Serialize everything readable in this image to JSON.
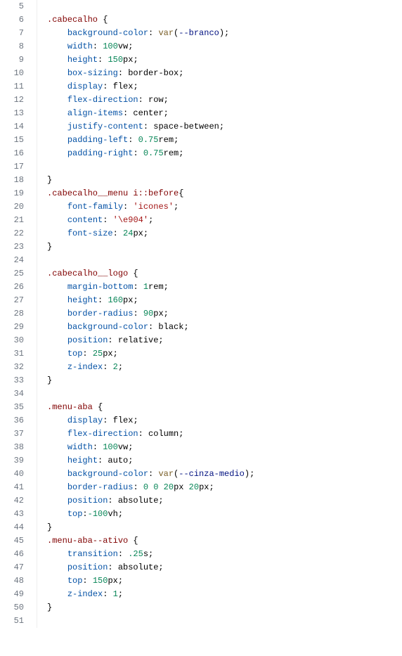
{
  "lines": [
    {
      "n": 5,
      "tokens": []
    },
    {
      "n": 6,
      "tokens": [
        [
          "sel",
          ".cabecalho"
        ],
        [
          "pun",
          " {"
        ]
      ]
    },
    {
      "n": 7,
      "tokens": [
        [
          "pun",
          "    "
        ],
        [
          "prop",
          "background-color"
        ],
        [
          "pun",
          ": "
        ],
        [
          "func",
          "var"
        ],
        [
          "pun",
          "("
        ],
        [
          "var",
          "--branco"
        ],
        [
          "pun",
          ");"
        ]
      ]
    },
    {
      "n": 8,
      "tokens": [
        [
          "pun",
          "    "
        ],
        [
          "prop",
          "width"
        ],
        [
          "pun",
          ": "
        ],
        [
          "num",
          "100"
        ],
        [
          "kw",
          "vw"
        ],
        [
          "pun",
          ";"
        ]
      ]
    },
    {
      "n": 9,
      "tokens": [
        [
          "pun",
          "    "
        ],
        [
          "prop",
          "height"
        ],
        [
          "pun",
          ": "
        ],
        [
          "num",
          "150"
        ],
        [
          "kw",
          "px"
        ],
        [
          "pun",
          ";"
        ]
      ]
    },
    {
      "n": 10,
      "tokens": [
        [
          "pun",
          "    "
        ],
        [
          "prop",
          "box-sizing"
        ],
        [
          "pun",
          ": border-box;"
        ]
      ]
    },
    {
      "n": 11,
      "tokens": [
        [
          "pun",
          "    "
        ],
        [
          "prop",
          "display"
        ],
        [
          "pun",
          ": flex;"
        ]
      ]
    },
    {
      "n": 12,
      "tokens": [
        [
          "pun",
          "    "
        ],
        [
          "prop",
          "flex-direction"
        ],
        [
          "pun",
          ": row;"
        ]
      ]
    },
    {
      "n": 13,
      "tokens": [
        [
          "pun",
          "    "
        ],
        [
          "prop",
          "align-items"
        ],
        [
          "pun",
          ": center;"
        ]
      ]
    },
    {
      "n": 14,
      "tokens": [
        [
          "pun",
          "    "
        ],
        [
          "prop",
          "justify-content"
        ],
        [
          "pun",
          ": space-between;"
        ]
      ]
    },
    {
      "n": 15,
      "tokens": [
        [
          "pun",
          "    "
        ],
        [
          "prop",
          "padding-left"
        ],
        [
          "pun",
          ": "
        ],
        [
          "num",
          "0.75"
        ],
        [
          "kw",
          "rem"
        ],
        [
          "pun",
          ";"
        ]
      ]
    },
    {
      "n": 16,
      "tokens": [
        [
          "pun",
          "    "
        ],
        [
          "prop",
          "padding-right"
        ],
        [
          "pun",
          ": "
        ],
        [
          "num",
          "0.75"
        ],
        [
          "kw",
          "rem"
        ],
        [
          "pun",
          ";"
        ]
      ]
    },
    {
      "n": 17,
      "tokens": []
    },
    {
      "n": 18,
      "tokens": [
        [
          "pun",
          "}"
        ]
      ]
    },
    {
      "n": 19,
      "tokens": [
        [
          "sel",
          ".cabecalho__menu"
        ],
        [
          "pun",
          " "
        ],
        [
          "sel",
          "i::before"
        ],
        [
          "pun",
          "{"
        ]
      ]
    },
    {
      "n": 20,
      "tokens": [
        [
          "pun",
          "    "
        ],
        [
          "prop",
          "font-family"
        ],
        [
          "pun",
          ": "
        ],
        [
          "str",
          "'icones'"
        ],
        [
          "pun",
          ";"
        ]
      ]
    },
    {
      "n": 21,
      "tokens": [
        [
          "pun",
          "    "
        ],
        [
          "prop",
          "content"
        ],
        [
          "pun",
          ": "
        ],
        [
          "str",
          "'\\e904'"
        ],
        [
          "pun",
          ";"
        ]
      ]
    },
    {
      "n": 22,
      "tokens": [
        [
          "pun",
          "    "
        ],
        [
          "prop",
          "font-size"
        ],
        [
          "pun",
          ": "
        ],
        [
          "num",
          "24"
        ],
        [
          "kw",
          "px"
        ],
        [
          "pun",
          ";"
        ]
      ]
    },
    {
      "n": 23,
      "tokens": [
        [
          "pun",
          "}"
        ]
      ]
    },
    {
      "n": 24,
      "tokens": []
    },
    {
      "n": 25,
      "tokens": [
        [
          "sel",
          ".cabecalho__logo"
        ],
        [
          "pun",
          " {"
        ]
      ]
    },
    {
      "n": 26,
      "tokens": [
        [
          "pun",
          "    "
        ],
        [
          "prop",
          "margin-bottom"
        ],
        [
          "pun",
          ": "
        ],
        [
          "num",
          "1"
        ],
        [
          "kw",
          "rem"
        ],
        [
          "pun",
          ";"
        ]
      ]
    },
    {
      "n": 27,
      "tokens": [
        [
          "pun",
          "    "
        ],
        [
          "prop",
          "height"
        ],
        [
          "pun",
          ": "
        ],
        [
          "num",
          "160"
        ],
        [
          "kw",
          "px"
        ],
        [
          "pun",
          ";"
        ]
      ]
    },
    {
      "n": 28,
      "tokens": [
        [
          "pun",
          "    "
        ],
        [
          "prop",
          "border-radius"
        ],
        [
          "pun",
          ": "
        ],
        [
          "num",
          "90"
        ],
        [
          "kw",
          "px"
        ],
        [
          "pun",
          ";"
        ]
      ]
    },
    {
      "n": 29,
      "tokens": [
        [
          "pun",
          "    "
        ],
        [
          "prop",
          "background-color"
        ],
        [
          "pun",
          ": black;"
        ]
      ]
    },
    {
      "n": 30,
      "tokens": [
        [
          "pun",
          "    "
        ],
        [
          "prop",
          "position"
        ],
        [
          "pun",
          ": relative;"
        ]
      ]
    },
    {
      "n": 31,
      "tokens": [
        [
          "pun",
          "    "
        ],
        [
          "prop",
          "top"
        ],
        [
          "pun",
          ": "
        ],
        [
          "num",
          "25"
        ],
        [
          "kw",
          "px"
        ],
        [
          "pun",
          ";"
        ]
      ]
    },
    {
      "n": 32,
      "tokens": [
        [
          "pun",
          "    "
        ],
        [
          "prop",
          "z-index"
        ],
        [
          "pun",
          ": "
        ],
        [
          "num",
          "2"
        ],
        [
          "pun",
          ";"
        ]
      ]
    },
    {
      "n": 33,
      "tokens": [
        [
          "pun",
          "}"
        ]
      ]
    },
    {
      "n": 34,
      "tokens": []
    },
    {
      "n": 35,
      "tokens": [
        [
          "sel",
          ".menu-aba"
        ],
        [
          "pun",
          " {"
        ]
      ]
    },
    {
      "n": 36,
      "tokens": [
        [
          "pun",
          "    "
        ],
        [
          "prop",
          "display"
        ],
        [
          "pun",
          ": flex;"
        ]
      ]
    },
    {
      "n": 37,
      "tokens": [
        [
          "pun",
          "    "
        ],
        [
          "prop",
          "flex-direction"
        ],
        [
          "pun",
          ": column;"
        ]
      ]
    },
    {
      "n": 38,
      "tokens": [
        [
          "pun",
          "    "
        ],
        [
          "prop",
          "width"
        ],
        [
          "pun",
          ": "
        ],
        [
          "num",
          "100"
        ],
        [
          "kw",
          "vw"
        ],
        [
          "pun",
          ";"
        ]
      ]
    },
    {
      "n": 39,
      "tokens": [
        [
          "pun",
          "    "
        ],
        [
          "prop",
          "height"
        ],
        [
          "pun",
          ": auto;"
        ]
      ]
    },
    {
      "n": 40,
      "tokens": [
        [
          "pun",
          "    "
        ],
        [
          "prop",
          "background-color"
        ],
        [
          "pun",
          ": "
        ],
        [
          "func",
          "var"
        ],
        [
          "pun",
          "("
        ],
        [
          "var",
          "--cinza-medio"
        ],
        [
          "pun",
          ");"
        ]
      ]
    },
    {
      "n": 41,
      "tokens": [
        [
          "pun",
          "    "
        ],
        [
          "prop",
          "border-radius"
        ],
        [
          "pun",
          ": "
        ],
        [
          "num",
          "0"
        ],
        [
          "pun",
          " "
        ],
        [
          "num",
          "0"
        ],
        [
          "pun",
          " "
        ],
        [
          "num",
          "20"
        ],
        [
          "kw",
          "px"
        ],
        [
          "pun",
          " "
        ],
        [
          "num",
          "20"
        ],
        [
          "kw",
          "px"
        ],
        [
          "pun",
          ";"
        ]
      ]
    },
    {
      "n": 42,
      "tokens": [
        [
          "pun",
          "    "
        ],
        [
          "prop",
          "position"
        ],
        [
          "pun",
          ": absolute;"
        ]
      ]
    },
    {
      "n": 43,
      "tokens": [
        [
          "pun",
          "    "
        ],
        [
          "prop",
          "top"
        ],
        [
          "pun",
          ":"
        ],
        [
          "num",
          "-100"
        ],
        [
          "kw",
          "vh"
        ],
        [
          "pun",
          ";"
        ]
      ]
    },
    {
      "n": 44,
      "tokens": [
        [
          "pun",
          "}"
        ]
      ]
    },
    {
      "n": 45,
      "tokens": [
        [
          "sel",
          ".menu-aba--ativo"
        ],
        [
          "pun",
          " {"
        ]
      ]
    },
    {
      "n": 46,
      "tokens": [
        [
          "pun",
          "    "
        ],
        [
          "prop",
          "transition"
        ],
        [
          "pun",
          ": "
        ],
        [
          "num",
          ".25"
        ],
        [
          "kw",
          "s"
        ],
        [
          "pun",
          ";"
        ]
      ]
    },
    {
      "n": 47,
      "tokens": [
        [
          "pun",
          "    "
        ],
        [
          "prop",
          "position"
        ],
        [
          "pun",
          ": absolute;"
        ]
      ]
    },
    {
      "n": 48,
      "tokens": [
        [
          "pun",
          "    "
        ],
        [
          "prop",
          "top"
        ],
        [
          "pun",
          ": "
        ],
        [
          "num",
          "150"
        ],
        [
          "kw",
          "px"
        ],
        [
          "pun",
          ";"
        ]
      ]
    },
    {
      "n": 49,
      "tokens": [
        [
          "pun",
          "    "
        ],
        [
          "prop",
          "z-index"
        ],
        [
          "pun",
          ": "
        ],
        [
          "num",
          "1"
        ],
        [
          "pun",
          ";"
        ]
      ]
    },
    {
      "n": 50,
      "tokens": [
        [
          "pun",
          "}"
        ]
      ]
    },
    {
      "n": 51,
      "tokens": []
    }
  ]
}
